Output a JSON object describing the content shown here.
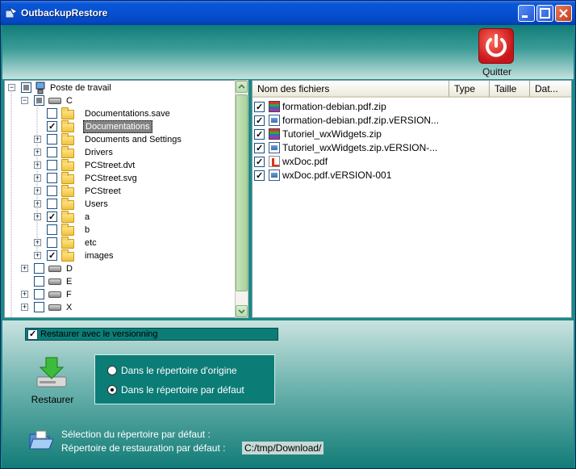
{
  "window": {
    "title": "OutbackupRestore"
  },
  "toolbar": {
    "quit_label": "Quitter"
  },
  "tree": {
    "root": "Poste de travail",
    "drive_c": "C",
    "items": [
      {
        "label": "Documentations.save",
        "checked": "none",
        "expandable": false
      },
      {
        "label": "Documentations",
        "checked": "checked",
        "expandable": false,
        "selected": true
      },
      {
        "label": "Documents and Settings",
        "checked": "none",
        "expandable": true
      },
      {
        "label": "Drivers",
        "checked": "none",
        "expandable": true
      },
      {
        "label": "PCStreet.dvt",
        "checked": "none",
        "expandable": true
      },
      {
        "label": "PCStreet.svg",
        "checked": "none",
        "expandable": true
      },
      {
        "label": "PCStreet",
        "checked": "none",
        "expandable": true
      },
      {
        "label": "Users",
        "checked": "none",
        "expandable": true
      },
      {
        "label": "a",
        "checked": "checked",
        "expandable": true
      },
      {
        "label": "b",
        "checked": "none",
        "expandable": false
      },
      {
        "label": "etc",
        "checked": "none",
        "expandable": true
      },
      {
        "label": "images",
        "checked": "checked",
        "expandable": true
      }
    ],
    "drives": [
      {
        "label": "D",
        "expandable": true
      },
      {
        "label": "E",
        "expandable": false
      },
      {
        "label": "F",
        "expandable": true
      },
      {
        "label": "X",
        "expandable": true
      }
    ]
  },
  "files": {
    "columns": [
      "Nom des fichiers",
      "Type",
      "Taille",
      "Dat..."
    ],
    "rows": [
      {
        "name": "formation-debian.pdf.zip",
        "icon": "zip-icon"
      },
      {
        "name": "formation-debian.pdf.zip.vERSION...",
        "icon": "document-icon"
      },
      {
        "name": "Tutoriel_wxWidgets.zip",
        "icon": "zip-icon"
      },
      {
        "name": "Tutoriel_wxWidgets.zip.vERSION-...",
        "icon": "document-icon"
      },
      {
        "name": "wxDoc.pdf",
        "icon": "pdf-icon"
      },
      {
        "name": "wxDoc.pdf.vERSION-001",
        "icon": "document-icon"
      }
    ]
  },
  "options": {
    "versioning_label": "Restaurer avec le versionning",
    "restore_label": "Restaurer",
    "radio_origin": "Dans le répertoire d'origine",
    "radio_default": "Dans le répertoire par défaut",
    "selected_radio": "default"
  },
  "footer": {
    "selection_label": "Sélection du répertoire par défaut :",
    "restore_dir_label": "Répertoire de restauration par défaut :",
    "restore_dir_value": "C:/tmp/Download/"
  },
  "colors": {
    "teal": "#0c7c76",
    "title_blue": "#0550d2",
    "quit_red": "#c8141a"
  }
}
